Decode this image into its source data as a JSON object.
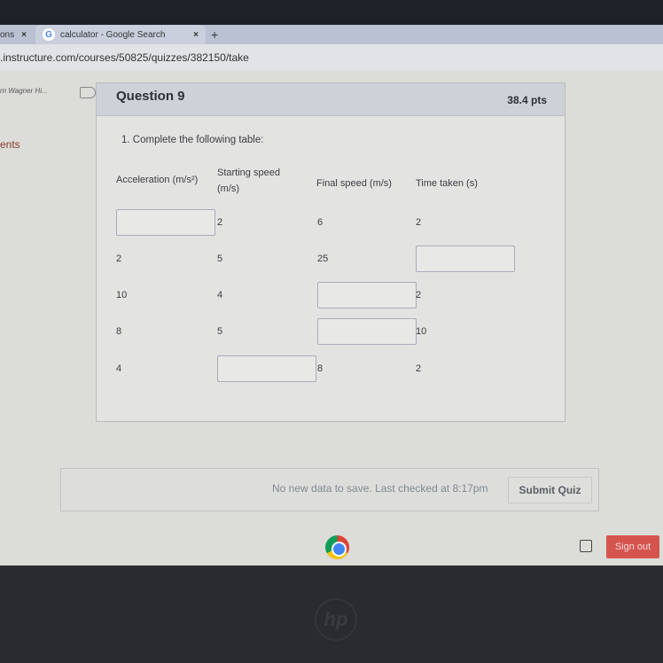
{
  "browser": {
    "tabs": [
      {
        "label": "ons",
        "close": "×"
      },
      {
        "label": "calculator - Google Search",
        "close": "×",
        "icon": "google-g-icon",
        "icon_text": "G"
      }
    ],
    "new_tab": "+",
    "url": ".instructure.com/courses/50825/quizzes/382150/take"
  },
  "sidebar": {
    "name": "rn Wagner Hi...",
    "link": "ents"
  },
  "question": {
    "title": "Question 9",
    "points": "38.4 pts",
    "prompt": "1. Complete the following table:",
    "headers": [
      "Acceleration (m/s²)",
      "Starting speed (m/s)",
      "Final speed (m/s)",
      "Time taken (s)"
    ],
    "rows": [
      [
        "",
        "2",
        "6",
        "2"
      ],
      [
        "2",
        "5",
        "25",
        ""
      ],
      [
        "10",
        "4",
        "",
        "2"
      ],
      [
        "8",
        "5",
        "",
        "10"
      ],
      [
        "4",
        "",
        "8",
        "2"
      ]
    ]
  },
  "footer": {
    "status": "No new data to save. Last checked at 8:17pm",
    "submit": "Submit Quiz"
  },
  "taskbar": {
    "sign_out": "Sign out",
    "sign_out_color": "#d6544e"
  },
  "logo": "hp"
}
